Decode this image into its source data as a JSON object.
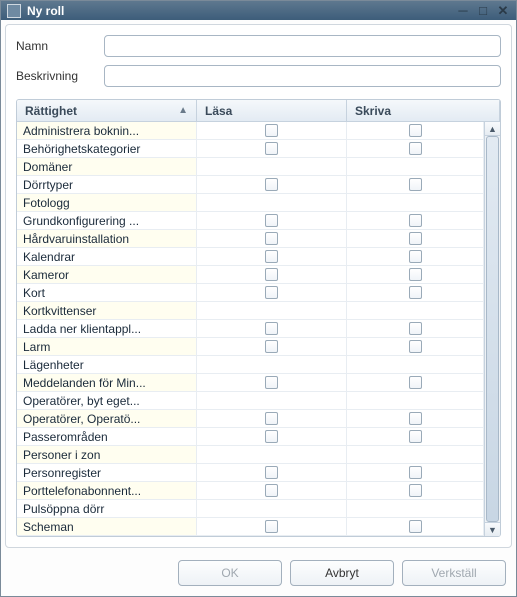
{
  "window": {
    "title": "Ny roll"
  },
  "form": {
    "name_label": "Namn",
    "name_value": "",
    "desc_label": "Beskrivning",
    "desc_value": ""
  },
  "grid": {
    "columns": {
      "right": "Rättighet",
      "read": "Läsa",
      "write": "Skriva"
    },
    "rows": [
      {
        "label": "Administrera boknin...",
        "read": true,
        "write": true
      },
      {
        "label": "Behörighetskategorier",
        "read": true,
        "write": true
      },
      {
        "label": "Domäner",
        "read": false,
        "write": false
      },
      {
        "label": "Dörrtyper",
        "read": true,
        "write": true
      },
      {
        "label": "Fotologg",
        "read": false,
        "write": false
      },
      {
        "label": "Grundkonfigurering ...",
        "read": true,
        "write": true
      },
      {
        "label": "Hårdvaruinstallation",
        "read": true,
        "write": true
      },
      {
        "label": "Kalendrar",
        "read": true,
        "write": true
      },
      {
        "label": "Kameror",
        "read": true,
        "write": true
      },
      {
        "label": "Kort",
        "read": true,
        "write": true
      },
      {
        "label": "Kortkvittenser",
        "read": false,
        "write": false
      },
      {
        "label": "Ladda ner klientappl...",
        "read": true,
        "write": true
      },
      {
        "label": "Larm",
        "read": true,
        "write": true
      },
      {
        "label": "Lägenheter",
        "read": false,
        "write": false
      },
      {
        "label": "Meddelanden för Min...",
        "read": true,
        "write": true
      },
      {
        "label": "Operatörer, byt eget...",
        "read": false,
        "write": false
      },
      {
        "label": "Operatörer, Operatö...",
        "read": true,
        "write": true
      },
      {
        "label": "Passerområden",
        "read": true,
        "write": true
      },
      {
        "label": "Personer i zon",
        "read": false,
        "write": false
      },
      {
        "label": "Personregister",
        "read": true,
        "write": true
      },
      {
        "label": "Porttelefonabonnent...",
        "read": true,
        "write": true
      },
      {
        "label": "Pulsöppna dörr",
        "read": false,
        "write": false
      },
      {
        "label": "Scheman",
        "read": true,
        "write": true
      }
    ]
  },
  "buttons": {
    "ok": "OK",
    "cancel": "Avbryt",
    "apply": "Verkställ"
  }
}
